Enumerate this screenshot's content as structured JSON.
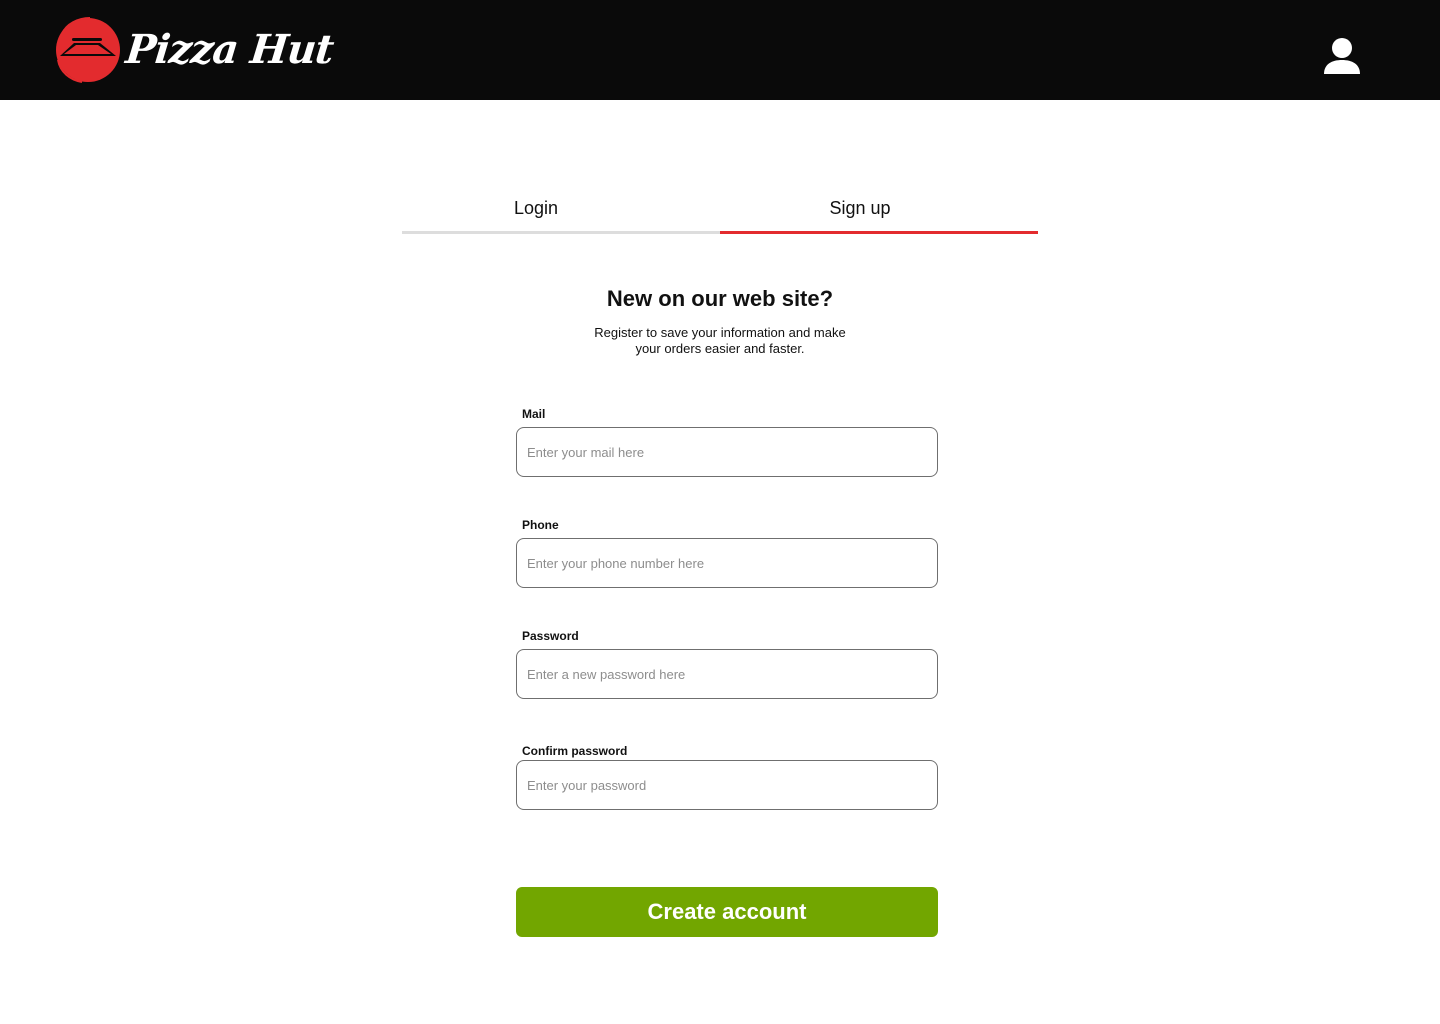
{
  "brand": {
    "name": "Pizza Hut",
    "logo_icon": "pizza-hut-roof-logo",
    "colors": {
      "header_bg": "#0a0a0a",
      "brand_red": "#e32b2e",
      "primary_green": "#72a600"
    }
  },
  "header": {
    "user_icon": "user-icon"
  },
  "tabs": [
    {
      "label": "Login",
      "active": false
    },
    {
      "label": "Sign up",
      "active": true
    }
  ],
  "signup": {
    "heading": "New on our web site?",
    "subtext_line1": "Register to save your information and make",
    "subtext_line2": "your orders easier and faster.",
    "fields": [
      {
        "label": "Mail",
        "placeholder": "Enter your mail here",
        "value": ""
      },
      {
        "label": "Phone",
        "placeholder": "Enter your phone number here",
        "value": ""
      },
      {
        "label": "Password",
        "placeholder": "Enter a new password here",
        "value": ""
      },
      {
        "label": "Confirm password",
        "placeholder": "Enter your password",
        "value": ""
      }
    ],
    "submit_label": "Create account"
  }
}
